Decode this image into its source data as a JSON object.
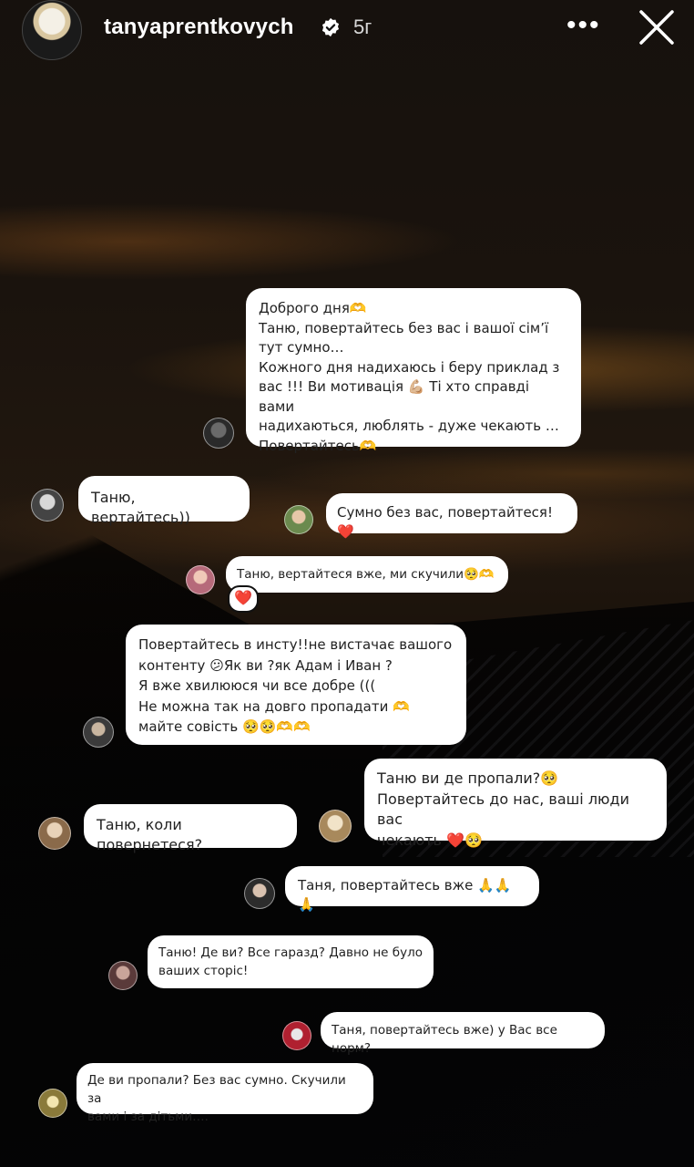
{
  "header": {
    "username": "tanyaprentkovych",
    "time": "5г",
    "more_label": "•••"
  },
  "messages": [
    {
      "lines": [
        "Доброго дня🫶",
        "Таню, повертайтесь без вас і вашої сім’ї",
        "тут сумно…",
        "Кожного дня надихаюсь і беру приклад з",
        "вас !!! Ви мотивація 💪🏼 Ті хто справді вами",
        "надихаються, люблять - дуже чекають …",
        "Повертайтесь🫶"
      ]
    },
    {
      "lines": [
        "Таню, вертайтесь))"
      ]
    },
    {
      "lines": [
        "Сумно без вас, повертайтеся!❤️"
      ]
    },
    {
      "lines": [
        "Таню, вертайтеся вже, ми скучили🥺🫶"
      ],
      "reaction": "❤️"
    },
    {
      "lines": [
        "Повертайтесь в инсту!!не вистачає вашого",
        "контенту 😕Як ви ?як Адам і Иван ?",
        "Я вже хвилююся чи все добре (((",
        "Не можна так на довго пропадати 🫶",
        "майте совість 🥺🥺🫶🫶"
      ]
    },
    {
      "lines": [
        "Таню ви де пропали?🥺",
        "Повертайтесь до нас, ваші люди вас",
        "чекають ❤️🥺"
      ]
    },
    {
      "lines": [
        "Таню, коли повернетеся?"
      ]
    },
    {
      "lines": [
        "Таня, повертайтесь вже 🙏🙏🙏"
      ]
    },
    {
      "lines": [
        "Таню! Де ви? Все гаразд? Давно не було",
        "ваших сторіс!"
      ]
    },
    {
      "lines": [
        "Таня, повертайтесь вже) у Вас все норм?"
      ]
    },
    {
      "lines": [
        "Де ви пропали? Без вас сумно. Скучили за",
        "вами і за дітьми…."
      ]
    }
  ]
}
